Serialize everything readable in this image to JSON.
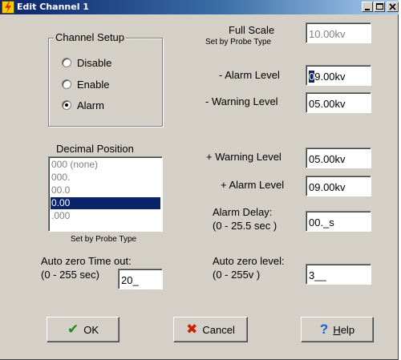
{
  "window": {
    "title": "Edit Channel 1"
  },
  "channel_setup": {
    "title": "Channel Setup",
    "options": [
      {
        "label": "Disable",
        "checked": false
      },
      {
        "label": "Enable",
        "checked": false
      },
      {
        "label": "Alarm",
        "checked": true
      }
    ]
  },
  "decimal_position": {
    "title": "Decimal Position",
    "items": [
      "000 (none)",
      "000.",
      "00.0",
      "0.00",
      ".000"
    ],
    "selected": "0.00",
    "note": "Set by Probe Type"
  },
  "auto_zero_time": {
    "label1": "Auto zero Time out:",
    "label2": "(0 - 255 sec)",
    "value": "20_"
  },
  "full_scale": {
    "label": "Full Scale",
    "note": "Set by Probe Type",
    "value": "10.00kv"
  },
  "minus_alarm": {
    "label": "- Alarm Level",
    "value_first": "0",
    "value_rest": "9.00kv"
  },
  "minus_warning": {
    "label": "- Warning Level",
    "value": "05.00kv"
  },
  "plus_warning": {
    "label": "+ Warning Level",
    "value": "05.00kv"
  },
  "plus_alarm": {
    "label": "+ Alarm Level",
    "value": "09.00kv"
  },
  "alarm_delay": {
    "label1": "Alarm Delay:",
    "label2": "(0 - 25.5 sec )",
    "value": "00._s"
  },
  "auto_zero_level": {
    "label1": "Auto zero level:",
    "label2": "(0 - 255v )",
    "value": "3__"
  },
  "buttons": {
    "ok": {
      "label": "OK",
      "icon": "check-icon",
      "color": "#1a8a1a"
    },
    "cancel": {
      "label": "Cancel",
      "icon": "x-icon",
      "color": "#cc2200"
    },
    "help": {
      "label_underlined": "H",
      "label_rest": "elp",
      "icon": "question-icon",
      "color": "#1a5fd0"
    }
  }
}
